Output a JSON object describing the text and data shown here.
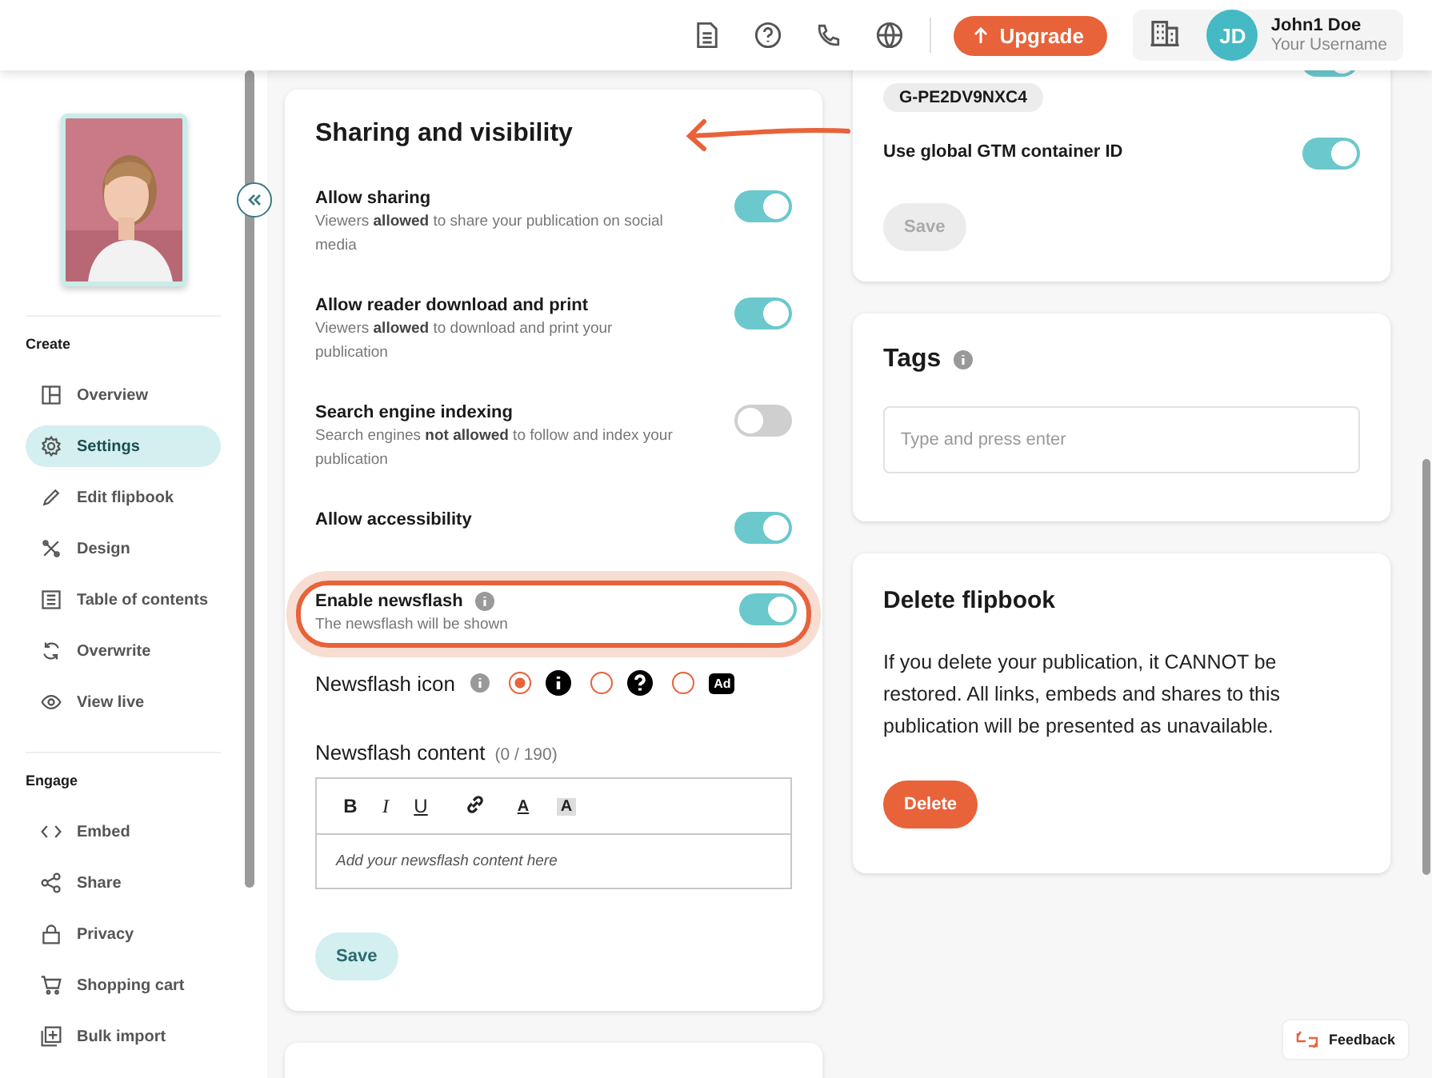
{
  "header": {
    "upgrade": "Upgrade",
    "avatar": "JD",
    "user_name": "John1 Doe",
    "user_sub": "Your Username"
  },
  "sidebar": {
    "sections": [
      {
        "title": "Create",
        "items": [
          {
            "label": "Overview",
            "kind": "overview",
            "selected": false
          },
          {
            "label": "Settings",
            "kind": "settings",
            "selected": true
          },
          {
            "label": "Edit flipbook",
            "kind": "edit",
            "selected": false
          },
          {
            "label": "Design",
            "kind": "design",
            "selected": false
          },
          {
            "label": "Table of contents",
            "kind": "toc",
            "selected": false
          },
          {
            "label": "Overwrite",
            "kind": "overwrite",
            "selected": false
          },
          {
            "label": "View live",
            "kind": "view",
            "selected": false
          }
        ]
      },
      {
        "title": "Engage",
        "items": [
          {
            "label": "Embed",
            "kind": "embed",
            "selected": false
          },
          {
            "label": "Share",
            "kind": "share",
            "selected": false
          },
          {
            "label": "Privacy",
            "kind": "privacy",
            "selected": false
          },
          {
            "label": "Shopping cart",
            "kind": "cart",
            "selected": false
          },
          {
            "label": "Bulk import",
            "kind": "import",
            "selected": false
          }
        ]
      }
    ]
  },
  "sharing": {
    "title": "Sharing and visibility",
    "toggles": [
      {
        "title": "Allow sharing",
        "description": "Viewers **allowed** to share your publication on social media",
        "on": true,
        "highlighted": false,
        "info": false
      },
      {
        "title": "Allow reader download and print",
        "description": "Viewers **allowed** to download and print your publication",
        "on": true,
        "highlighted": false,
        "info": false
      },
      {
        "title": "Search engine indexing",
        "description": "Search engines **not allowed** to follow and index your publication",
        "on": false,
        "highlighted": false,
        "info": false
      },
      {
        "title": "Allow accessibility",
        "on": true,
        "highlighted": false,
        "info": false
      },
      {
        "title": "Enable newsflash",
        "description": "The newsflash will be shown",
        "on": true,
        "highlighted": true,
        "info": true
      }
    ],
    "newsflash_icon": {
      "label": "Newsflash icon",
      "options": [
        {
          "kind": "info",
          "selected": true
        },
        {
          "kind": "question",
          "selected": false
        },
        {
          "kind": "ad",
          "text": "Ad",
          "selected": false
        }
      ]
    },
    "newsflash_content": {
      "label": "Newsflash content",
      "counter": "(0 / 190)",
      "toolbar": [
        {
          "kind": "bold",
          "text": "B"
        },
        {
          "kind": "italic",
          "text": "I"
        },
        {
          "kind": "underline",
          "text": "U"
        },
        {
          "kind": "link"
        },
        {
          "kind": "color",
          "text": "A"
        },
        {
          "kind": "background",
          "text": "A"
        }
      ],
      "placeholder": "Add your newsflash content here"
    },
    "save": "Save"
  },
  "tracking": {
    "chip": "G-PE2DV9NXC4",
    "chip_toggle_on": true,
    "rows": [
      {
        "label": "Use global GTM container ID",
        "on": true
      }
    ],
    "save": "Save",
    "save_disabled": true
  },
  "tags": {
    "title": "Tags",
    "placeholder": "Type and press enter"
  },
  "delete": {
    "title": "Delete flipbook",
    "text": "If you delete your publication, it CANNOT be restored. All links, embeds and shares to this publication will be presented as unavailable.",
    "button": "Delete"
  },
  "feedback": "Feedback"
}
